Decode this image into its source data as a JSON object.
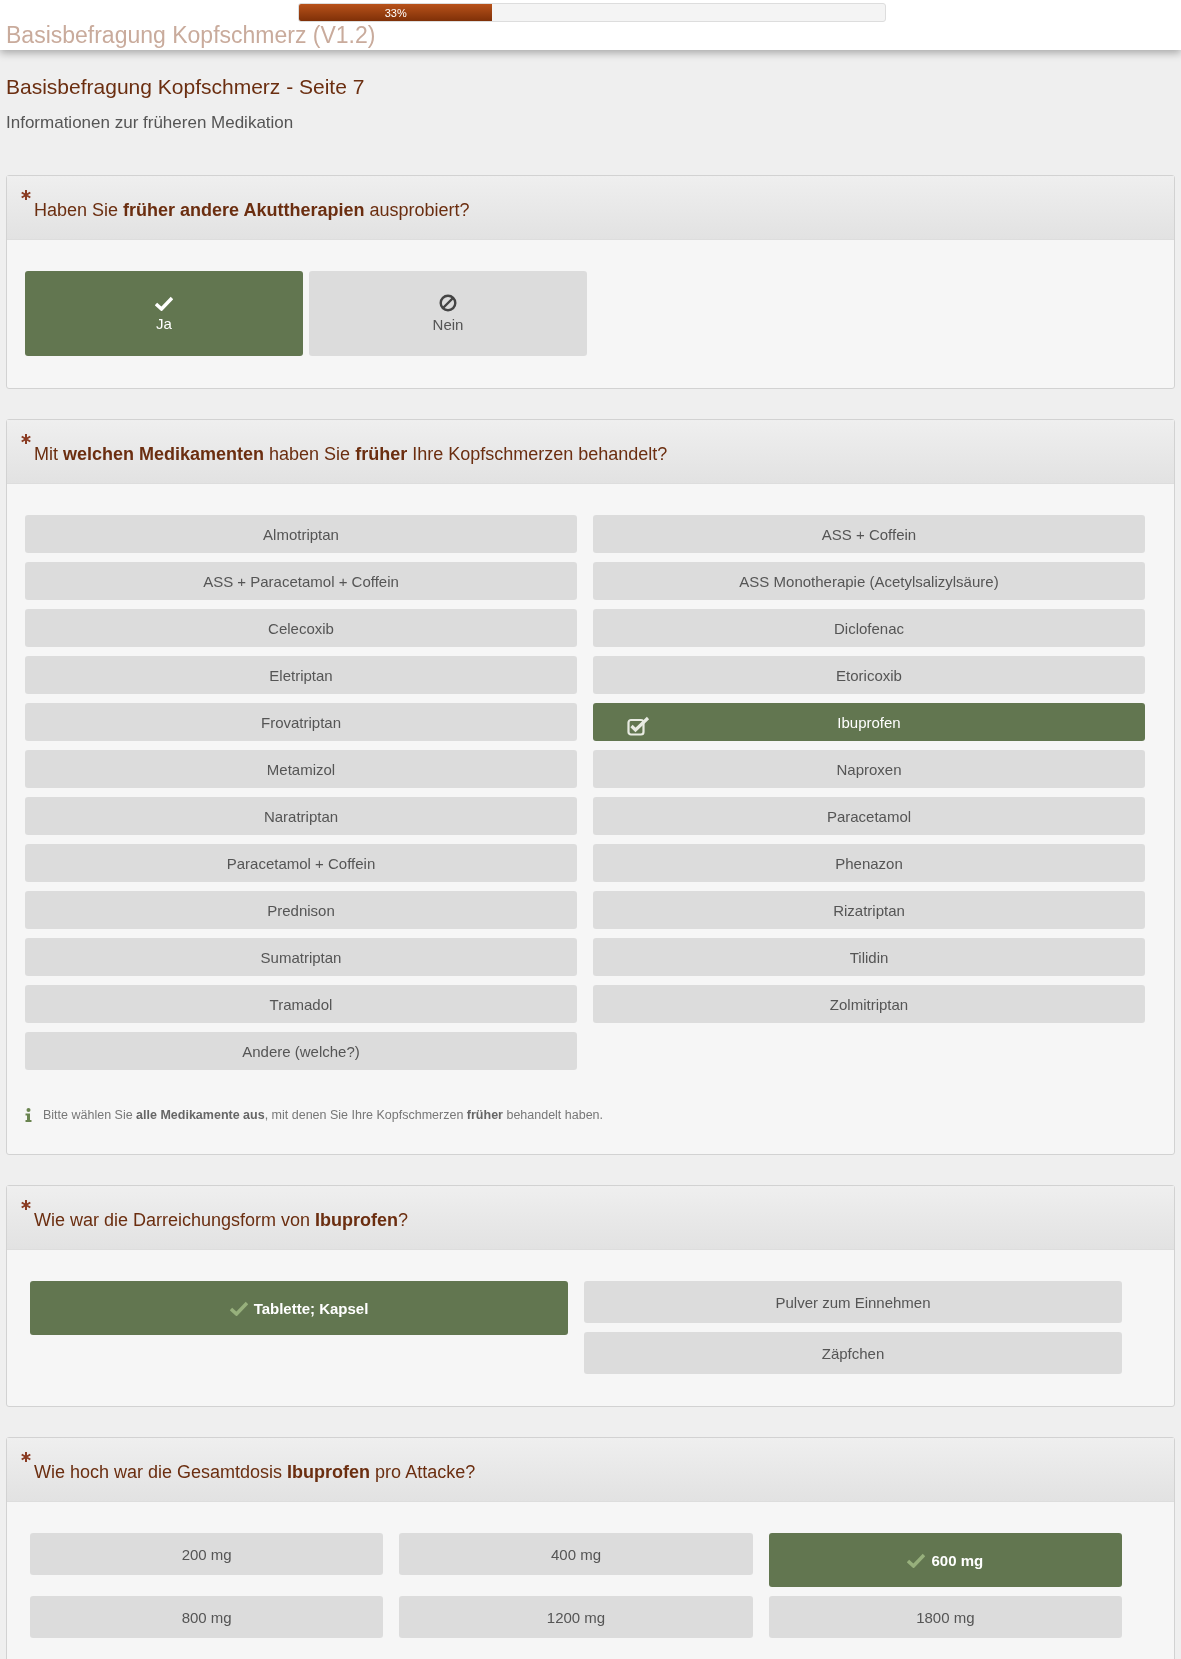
{
  "header": {
    "title": "Basisbefragung Kopfschmerz (V1.2)",
    "progress": {
      "level": 0.33,
      "label": "33%"
    }
  },
  "page_title": "Basisbefragung Kopfschmerz - Seite 7",
  "page_subtitle": "Informationen zur früheren Medikation",
  "questions": [
    {
      "kind": "yesno",
      "required": true,
      "text": "Haben Sie **früher andere Akuttherapien** ausprobiert?",
      "options": [
        {
          "kind": "yes",
          "label": "Ja",
          "selected": true
        },
        {
          "kind": "no",
          "label": "Nein",
          "selected": false
        }
      ]
    },
    {
      "kind": "multi",
      "required": true,
      "text": "Mit **welchen Medikamenten** haben Sie **früher** Ihre Kopfschmerzen behandelt?",
      "options": [
        {
          "label": "Almotriptan",
          "selected": false
        },
        {
          "label": "ASS + Coffein",
          "selected": false
        },
        {
          "label": "ASS + Paracetamol + Coffein",
          "selected": false
        },
        {
          "label": "ASS Monotherapie (Acetylsalizylsäure)",
          "selected": false
        },
        {
          "label": "Celecoxib",
          "selected": false
        },
        {
          "label": "Diclofenac",
          "selected": false
        },
        {
          "label": "Eletriptan",
          "selected": false
        },
        {
          "label": "Etoricoxib",
          "selected": false
        },
        {
          "label": "Frovatriptan",
          "selected": false
        },
        {
          "label": "Ibuprofen",
          "selected": true
        },
        {
          "label": "Metamizol",
          "selected": false
        },
        {
          "label": "Naproxen",
          "selected": false
        },
        {
          "label": "Naratriptan",
          "selected": false
        },
        {
          "label": "Paracetamol",
          "selected": false
        },
        {
          "label": "Paracetamol + Coffein",
          "selected": false
        },
        {
          "label": "Phenazon",
          "selected": false
        },
        {
          "label": "Prednison",
          "selected": false
        },
        {
          "label": "Rizatriptan",
          "selected": false
        },
        {
          "label": "Sumatriptan",
          "selected": false
        },
        {
          "label": "Tilidin",
          "selected": false
        },
        {
          "label": "Tramadol",
          "selected": false
        },
        {
          "label": "Zolmitriptan",
          "selected": false
        },
        {
          "label": "Andere (welche?)",
          "selected": false
        }
      ],
      "hint": "Bitte wählen Sie **alle Medikamente aus**, mit denen Sie Ihre Kopfschmerzen **früher** behandelt haben."
    },
    {
      "kind": "columns",
      "required": true,
      "text": "Wie war die Darreichungsform von **Ibuprofen**?",
      "columns": [
        [
          {
            "label": "Tablette; Kapsel",
            "selected": true
          }
        ],
        [
          {
            "label": "Pulver zum Einnehmen",
            "selected": false
          },
          {
            "label": "Zäpfchen",
            "selected": false
          }
        ]
      ]
    },
    {
      "kind": "grid3",
      "required": true,
      "text": "Wie hoch war die Gesamtdosis **Ibuprofen** pro Attacke?",
      "options": [
        {
          "label": "200 mg",
          "selected": false
        },
        {
          "label": "400 mg",
          "selected": false
        },
        {
          "label": "600 mg",
          "selected": true
        },
        {
          "label": "800 mg",
          "selected": false
        },
        {
          "label": "1200 mg",
          "selected": false
        },
        {
          "label": "1800 mg",
          "selected": false
        }
      ]
    }
  ]
}
